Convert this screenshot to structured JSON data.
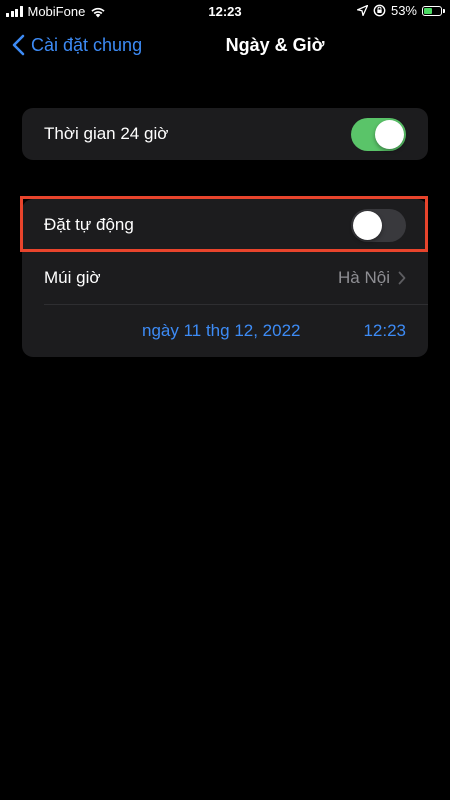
{
  "status_bar": {
    "carrier": "MobiFone",
    "time": "12:23",
    "battery_percent": "53%",
    "battery_level": 0.53
  },
  "nav": {
    "back_label": "Cài đặt chung",
    "title": "Ngày & Giờ"
  },
  "group1": {
    "time24_label": "Thời gian 24 giờ",
    "time24_on": true
  },
  "group2": {
    "auto_label": "Đặt tự động",
    "auto_on": false,
    "timezone_label": "Múi giờ",
    "timezone_value": "Hà Nội",
    "date_value": "ngày 11 thg 12, 2022",
    "time_value": "12:23"
  },
  "colors": {
    "accent": "#3d8bf5",
    "toggle_on": "#5ac469",
    "highlight": "#e8442c"
  }
}
